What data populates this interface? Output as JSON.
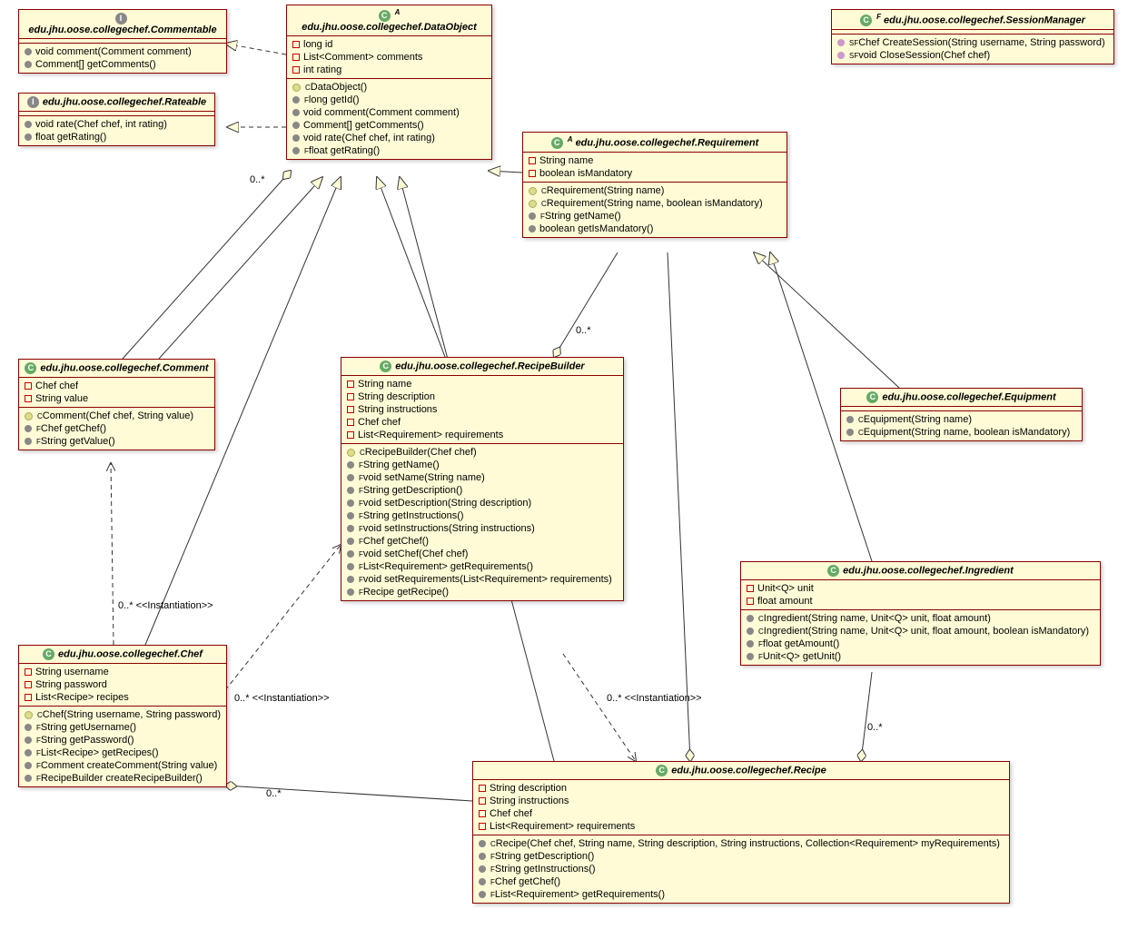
{
  "classes": {
    "commentable": {
      "title": "edu.jhu.oose.collegechef.Commentable",
      "type": "I",
      "methods": [
        "void comment(Comment comment)",
        "Comment[] getComments()"
      ]
    },
    "rateable": {
      "title": "edu.jhu.oose.collegechef.Rateable",
      "type": "I",
      "methods": [
        "void rate(Chef chef, int rating)",
        "float getRating()"
      ]
    },
    "dataobject": {
      "title": "edu.jhu.oose.collegechef.DataObject",
      "type": "C",
      "typeSup": "A",
      "fields": [
        "long id",
        "List<Comment> comments",
        "int rating"
      ],
      "methods": [
        {
          "t": "DataObject()",
          "k": "ctor"
        },
        {
          "t": "long getId()",
          "sup": "F"
        },
        {
          "t": "void comment(Comment comment)"
        },
        {
          "t": "Comment[] getComments()"
        },
        {
          "t": "void rate(Chef chef, int rating)"
        },
        {
          "t": "float getRating()",
          "sup": "F"
        }
      ]
    },
    "sessionmanager": {
      "title": "edu.jhu.oose.collegechef.SessionManager",
      "type": "C",
      "typeSup": "F",
      "methods": [
        {
          "t": "Chef CreateSession(String username, String password)",
          "sup": "SF",
          "k": "sf"
        },
        {
          "t": "void CloseSession(Chef chef)",
          "sup": "SF",
          "k": "sf"
        }
      ]
    },
    "requirement": {
      "title": "edu.jhu.oose.collegechef.Requirement",
      "type": "C",
      "typeSup": "A",
      "fields": [
        "String name",
        "boolean isMandatory"
      ],
      "methods": [
        {
          "t": "Requirement(String name)",
          "k": "ctor",
          "sup": "C"
        },
        {
          "t": "Requirement(String name, boolean isMandatory)",
          "k": "ctor",
          "sup": "C"
        },
        {
          "t": "String getName()",
          "sup": "F"
        },
        {
          "t": "boolean getIsMandatory()"
        }
      ]
    },
    "comment": {
      "title": "edu.jhu.oose.collegechef.Comment",
      "type": "C",
      "fields": [
        "Chef chef",
        "String value"
      ],
      "methods": [
        {
          "t": "Comment(Chef chef, String value)",
          "k": "ctor",
          "sup": "C"
        },
        {
          "t": "Chef getChef()",
          "sup": "F"
        },
        {
          "t": "String getValue()",
          "sup": "F"
        }
      ]
    },
    "recipebuilder": {
      "title": "edu.jhu.oose.collegechef.RecipeBuilder",
      "type": "C",
      "fields": [
        "String name",
        "String description",
        "String instructions",
        "Chef chef",
        "List<Requirement> requirements"
      ],
      "methods": [
        {
          "t": "RecipeBuilder(Chef chef)",
          "k": "ctor",
          "sup": "C"
        },
        {
          "t": "String getName()",
          "sup": "F"
        },
        {
          "t": "void setName(String name)",
          "sup": "F"
        },
        {
          "t": "String getDescription()",
          "sup": "F"
        },
        {
          "t": "void setDescription(String description)",
          "sup": "F"
        },
        {
          "t": "String getInstructions()",
          "sup": "F"
        },
        {
          "t": "void setInstructions(String instructions)",
          "sup": "F"
        },
        {
          "t": "Chef getChef()",
          "sup": "F"
        },
        {
          "t": "void setChef(Chef chef)",
          "sup": "F"
        },
        {
          "t": "List<Requirement> getRequirements()",
          "sup": "F"
        },
        {
          "t": "void setRequirements(List<Requirement> requirements)",
          "sup": "F"
        },
        {
          "t": "Recipe getRecipe()",
          "sup": "F"
        }
      ]
    },
    "equipment": {
      "title": "edu.jhu.oose.collegechef.Equipment",
      "type": "C",
      "methods": [
        {
          "t": "Equipment(String name)",
          "k": "ctor",
          "sup": "C"
        },
        {
          "t": "Equipment(String name, boolean isMandatory)",
          "k": "ctor",
          "sup": "C"
        }
      ]
    },
    "ingredient": {
      "title": "edu.jhu.oose.collegechef.Ingredient",
      "type": "C",
      "fields": [
        "Unit<Q> unit",
        "float amount"
      ],
      "methods": [
        {
          "t": "Ingredient(String name, Unit<Q> unit, float amount)",
          "k": "ctor",
          "sup": "C"
        },
        {
          "t": "Ingredient(String name, Unit<Q> unit, float amount, boolean isMandatory)",
          "k": "ctor",
          "sup": "C"
        },
        {
          "t": "float getAmount()",
          "sup": "F"
        },
        {
          "t": "Unit<Q> getUnit()",
          "sup": "F"
        }
      ]
    },
    "chef": {
      "title": "edu.jhu.oose.collegechef.Chef",
      "type": "C",
      "fields": [
        "String username",
        "String password",
        "List<Recipe> recipes"
      ],
      "methods": [
        {
          "t": "Chef(String username, String password)",
          "k": "ctor",
          "sup": "C"
        },
        {
          "t": "String getUsername()",
          "sup": "F"
        },
        {
          "t": "String getPassword()",
          "sup": "F"
        },
        {
          "t": "List<Recipe> getRecipes()",
          "sup": "F"
        },
        {
          "t": "Comment createComment(String value)",
          "sup": "F"
        },
        {
          "t": "RecipeBuilder createRecipeBuilder()",
          "sup": "F"
        }
      ]
    },
    "recipe": {
      "title": "edu.jhu.oose.collegechef.Recipe",
      "type": "C",
      "fields": [
        "String description",
        "String instructions",
        "Chef chef",
        "List<Requirement> requirements"
      ],
      "methods": [
        {
          "t": "Recipe(Chef chef, String name, String description, String instructions, Collection<Requirement> myRequirements)",
          "k": "ctor",
          "sup": "C"
        },
        {
          "t": "String getDescription()",
          "sup": "F"
        },
        {
          "t": "String getInstructions()",
          "sup": "F"
        },
        {
          "t": "Chef getChef()",
          "sup": "F"
        },
        {
          "t": "List<Requirement> getRequirements()",
          "sup": "F"
        }
      ]
    }
  },
  "labels": {
    "mult1": "0..*",
    "mult2": "0..*",
    "mult3": "0..*",
    "mult4": "0..*",
    "mult5": "0..*",
    "inst1": "0..* <<Instantiation>>",
    "inst2": "0..* <<Instantiation>>",
    "inst3": "0..* <<Instantiation>>"
  }
}
